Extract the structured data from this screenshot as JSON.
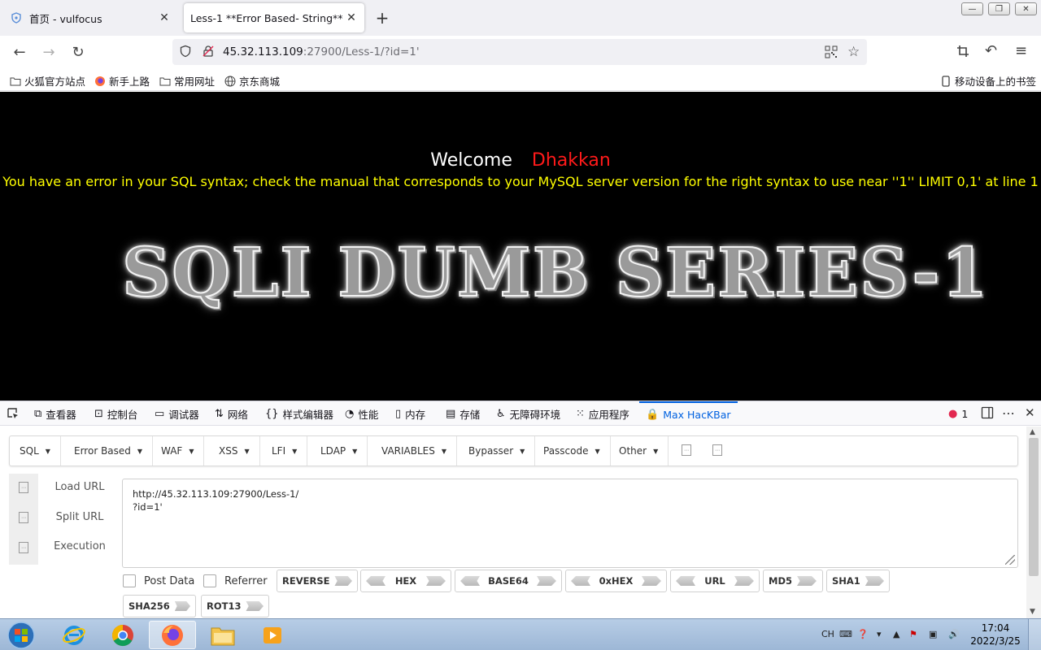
{
  "tabs": [
    {
      "title": "首页 - vulfocus",
      "active": false
    },
    {
      "title": "Less-1 **Error Based- String**",
      "active": true
    }
  ],
  "window_controls": {
    "minimize": "—",
    "restore": "❐",
    "close": "✕"
  },
  "address": {
    "host": "45.32.113.109",
    "rest": ":27900/Less-1/?id=1'"
  },
  "bookmarks": [
    {
      "label": "火狐官方站点",
      "icon": "folder-icon"
    },
    {
      "label": "新手上路",
      "icon": "firefox-icon"
    },
    {
      "label": "常用网址",
      "icon": "folder-icon"
    },
    {
      "label": "京东商城",
      "icon": "globe-icon"
    }
  ],
  "mobile_bookmarks": "移动设备上的书签",
  "page": {
    "welcome": "Welcome",
    "name": "Dhakkan",
    "error": "You have an error in your SQL syntax; check the manual that corresponds to your MySQL server version for the right syntax to use near ''1'' LIMIT 0,1' at line 1",
    "logo": "SQLI DUMB SERIES-1"
  },
  "devtools": {
    "tabs": [
      "查看器",
      "控制台",
      "调试器",
      "网络",
      "样式编辑器",
      "性能",
      "内存",
      "存储",
      "无障碍环境",
      "应用程序",
      "Max HacKBar"
    ],
    "active_tab": "Max HacKBar",
    "error_count": "1"
  },
  "hackbar": {
    "menus": [
      "SQL",
      "Error Based",
      "WAF",
      "XSS",
      "LFI",
      "LDAP",
      "VARIABLES",
      "Bypasser",
      "Passcode",
      "Other"
    ],
    "actions": [
      "Load URL",
      "Split URL",
      "Execution"
    ],
    "url_line1": "http://45.32.113.109:27900/Less-1/",
    "url_line2": "?id=1'",
    "post_data": "Post Data",
    "referrer": "Referrer",
    "encoders": [
      "REVERSE",
      "HEX",
      "BASE64",
      "0xHEX",
      "URL",
      "MD5",
      "SHA1",
      "SHA256",
      "ROT13"
    ]
  },
  "taskbar": {
    "time": "17:04",
    "date": "2022/3/25",
    "ime": "CH"
  }
}
